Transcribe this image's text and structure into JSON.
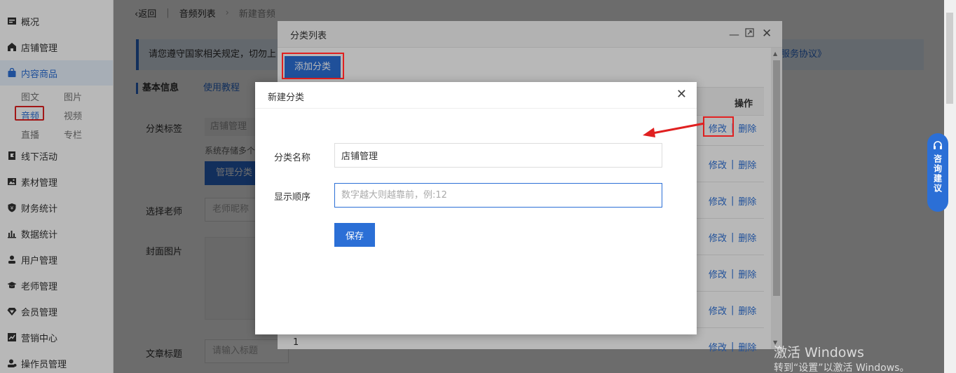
{
  "sidebar": {
    "items": [
      {
        "label": "概况",
        "icon": "overview-icon"
      },
      {
        "label": "店铺管理",
        "icon": "store-icon"
      },
      {
        "label": "内容商品",
        "icon": "bag-icon"
      },
      {
        "label": "线下活动",
        "icon": "flag-icon"
      },
      {
        "label": "素材管理",
        "icon": "image-icon"
      },
      {
        "label": "财务统计",
        "icon": "shield-money-icon"
      },
      {
        "label": "数据统计",
        "icon": "bar-chart-icon"
      },
      {
        "label": "用户管理",
        "icon": "user-icon"
      },
      {
        "label": "老师管理",
        "icon": "teacher-icon"
      },
      {
        "label": "会员管理",
        "icon": "diamond-icon"
      },
      {
        "label": "营销中心",
        "icon": "trend-icon"
      },
      {
        "label": "操作员管理",
        "icon": "operator-icon"
      }
    ],
    "sub_items": [
      "图文",
      "图片",
      "音频",
      "视频",
      "直播",
      "专栏"
    ],
    "accent_color": "#2b6fd6"
  },
  "background_page": {
    "back": "返回",
    "crumb1": "音频列表",
    "crumb2": "新建音频",
    "notice": "请您遵守国家相关规定，切勿上",
    "notice_link": "服务协议》",
    "section_title": "基本信息",
    "section_link": "使用教程",
    "label_category": "分类标签",
    "tag_value": "店铺管理",
    "storage_hint": "系统存储多个",
    "manage_button": "管理分类",
    "label_teacher": "选择老师",
    "teacher_placeholder": "老师昵称",
    "label_cover": "封面图片",
    "label_article_title": "文章标题",
    "title_placeholder": "请输入标题"
  },
  "category_window": {
    "title": "分类列表",
    "add_button": "添加分类",
    "op_header": "操作",
    "edit": "修改",
    "separator": "|",
    "delete": "删除",
    "last_row_number": "1"
  },
  "new_category_dialog": {
    "title": "新建分类",
    "name_label": "分类名称",
    "name_value": "店铺管理",
    "order_label": "显示顺序",
    "order_placeholder": "数字越大则越靠前，例:12",
    "save_button": "保存"
  },
  "consult": {
    "label": "咨询建议"
  },
  "watermark": {
    "line1": "激活 Windows",
    "line2": "转到“设置”以激活 Windows。"
  }
}
